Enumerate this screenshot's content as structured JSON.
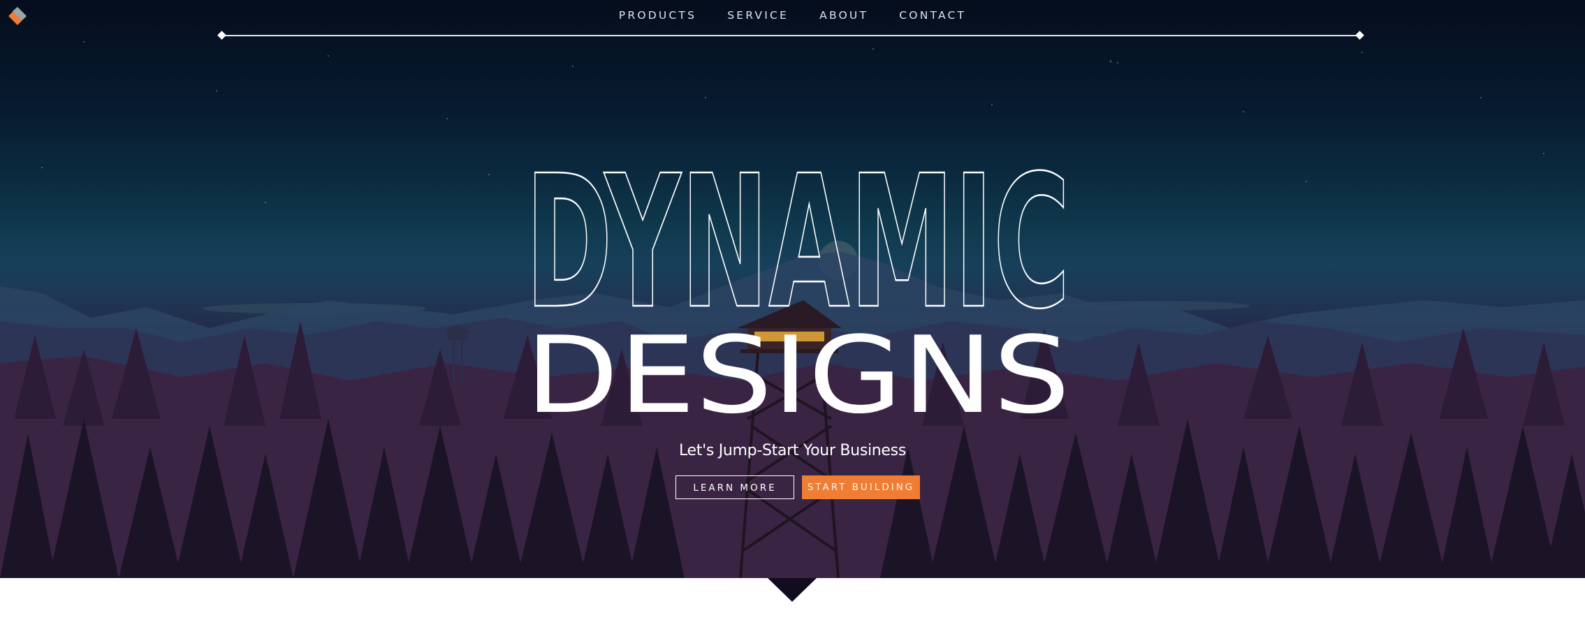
{
  "nav": {
    "items": [
      {
        "label": "PRODUCTS"
      },
      {
        "label": "SERVICE"
      },
      {
        "label": "ABOUT"
      },
      {
        "label": "CONTACT"
      }
    ]
  },
  "hero": {
    "title_line1": "DYNAMIC",
    "title_line2": "DESIGNS",
    "tagline": "Let's Jump-Start Your Business",
    "buttons": {
      "learn_more": "LEARN MORE",
      "start_building": "START BUILDING"
    }
  },
  "colors": {
    "accent": "#ef7d33",
    "sky_top": "#050d1c",
    "ground": "#120c1f",
    "text": "#ffffff"
  },
  "icons": {
    "logo": "diamond-logo-icon",
    "scroll_indicator": "triangle-down-icon"
  }
}
